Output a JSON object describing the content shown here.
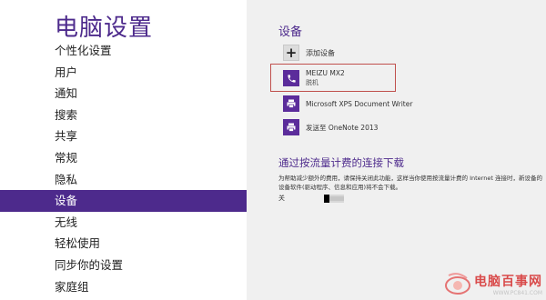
{
  "app_title": "电脑设置",
  "nav": {
    "items": [
      {
        "label": "个性化设置"
      },
      {
        "label": "用户"
      },
      {
        "label": "通知"
      },
      {
        "label": "搜索"
      },
      {
        "label": "共享"
      },
      {
        "label": "常规"
      },
      {
        "label": "隐私"
      },
      {
        "label": "设备",
        "selected": true
      },
      {
        "label": "无线"
      },
      {
        "label": "轻松使用"
      },
      {
        "label": "同步你的设置"
      },
      {
        "label": "家庭组"
      }
    ]
  },
  "devices": {
    "section_title": "设备",
    "add_label": "添加设备",
    "items": [
      {
        "name": "MEIZU MX2",
        "sub": "脱机",
        "icon": "phone-icon"
      },
      {
        "name": "Microsoft XPS Document Writer",
        "sub": "",
        "icon": "printer-icon"
      },
      {
        "name": "发送至 OneNote 2013",
        "sub": "",
        "icon": "printer-icon"
      }
    ]
  },
  "metered": {
    "title": "通过按流量计费的连接下载",
    "description": "为帮助减少额外的费用，请保持关闭此功能，这样当你使用按流量计费的 Internet 连接时，新设备的设备软件(驱动程序、信息和应用)将不会下载。",
    "toggle_label": "关",
    "toggle_on": false
  },
  "watermark": {
    "text": "电脑百事网",
    "url": "WWW.PC841.COM"
  },
  "colors": {
    "accent": "#4d2a8c",
    "tile": "#5b2c9b",
    "highlight": "#c0504d"
  }
}
